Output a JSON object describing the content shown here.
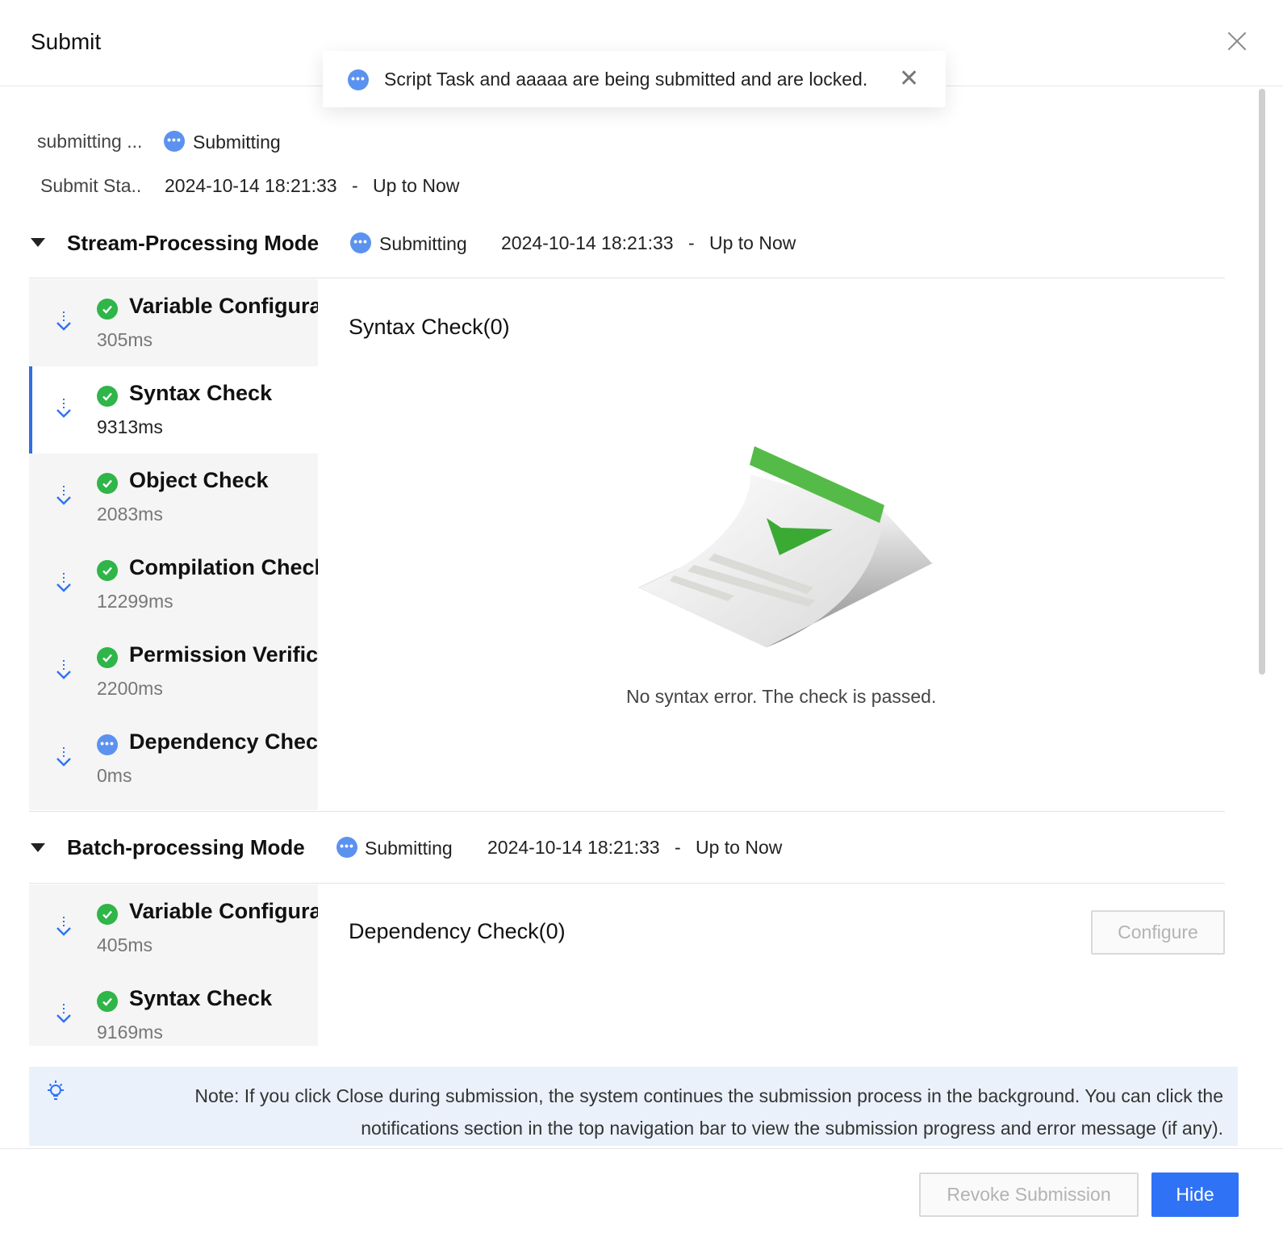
{
  "dialog": {
    "title": "Submit"
  },
  "toast": {
    "message": "Script Task and aaaaa are being submitted and are locked.",
    "close": "✕"
  },
  "summary": {
    "status_label": "submitting ...",
    "status_value": "Submitting",
    "time_label": "Submit Sta..",
    "time_start": "2024-10-14 18:21:33",
    "time_sep": "-",
    "time_end": "Up to Now"
  },
  "stream": {
    "title": "Stream-Processing Mode",
    "status": "Submitting",
    "time_start": "2024-10-14 18:21:33",
    "time_sep": "-",
    "time_end": "Up to Now",
    "steps": [
      {
        "name": "Variable Configuration",
        "time": "305ms",
        "state": "done"
      },
      {
        "name": "Syntax Check",
        "time": "9313ms",
        "state": "done"
      },
      {
        "name": "Object Check",
        "time": "2083ms",
        "state": "done"
      },
      {
        "name": "Compilation Check",
        "time": "12299ms",
        "state": "done"
      },
      {
        "name": "Permission Verification",
        "time": "2200ms",
        "state": "done"
      },
      {
        "name": "Dependency Check",
        "time": "0ms",
        "state": "running"
      }
    ],
    "pane_title": "Syntax Check(0)",
    "empty_text": "No syntax error. The check is passed."
  },
  "batch": {
    "title": "Batch-processing Mode",
    "status": "Submitting",
    "time_start": "2024-10-14 18:21:33",
    "time_sep": "-",
    "time_end": "Up to Now",
    "steps": [
      {
        "name": "Variable Configuration",
        "time": "405ms",
        "state": "done"
      },
      {
        "name": "Syntax Check",
        "time": "9169ms",
        "state": "done"
      }
    ],
    "pane_title": "Dependency Check(0)",
    "configure_label": "Configure"
  },
  "note": {
    "line1": "Note: If you click Close during submission, the system continues the submission process in the background. You can click the",
    "line2": "notifications section in the top navigation bar to view the submission progress and error message (if any)."
  },
  "footer": {
    "revoke_label": "Revoke Submission",
    "hide_label": "Hide"
  },
  "colors": {
    "accent": "#2f72f5",
    "success": "#2fb548",
    "running": "#5b92f0"
  }
}
